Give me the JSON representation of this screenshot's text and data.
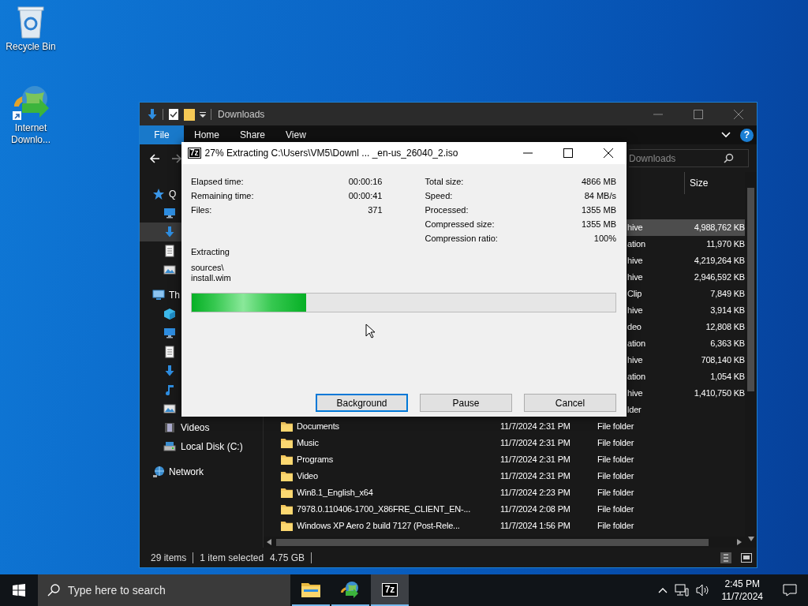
{
  "desktop_icons": [
    {
      "kind": "recycle-bin",
      "label": "Recycle Bin"
    },
    {
      "kind": "downloader",
      "label": "Internet Downlo..."
    }
  ],
  "explorer": {
    "title": "Downloads",
    "ribbon_tabs": [
      {
        "kind": "file",
        "label": "File"
      },
      {
        "kind": "tab",
        "label": "Home"
      },
      {
        "kind": "tab",
        "label": "Share"
      },
      {
        "kind": "tab",
        "label": "View"
      }
    ],
    "help_label": "?",
    "search": {
      "placeholder": "Downloads"
    },
    "columns": [
      {
        "label": "Size"
      }
    ],
    "nav": [
      {
        "kind": "star",
        "label": "Q",
        "selected": false,
        "children": [
          {
            "kind": "monitor",
            "selected": false
          },
          {
            "kind": "download",
            "selected": true
          },
          {
            "kind": "document",
            "selected": false
          },
          {
            "kind": "picture",
            "selected": false
          }
        ]
      },
      {
        "kind": "computer",
        "label": "Th",
        "selected": false,
        "children": [
          {
            "kind": "cube",
            "selected": false
          },
          {
            "kind": "monitor",
            "selected": false
          },
          {
            "kind": "document",
            "selected": false
          },
          {
            "kind": "download",
            "selected": false
          },
          {
            "kind": "music",
            "selected": false
          },
          {
            "kind": "picture",
            "selected": false
          },
          {
            "kind": "film",
            "label": "Videos",
            "selected": false
          },
          {
            "kind": "drive",
            "label": "Local Disk (C:)",
            "selected": false
          }
        ]
      },
      {
        "kind": "network",
        "label": "Network",
        "selected": false
      }
    ],
    "files": [
      {
        "kind": "covered",
        "type": "hive",
        "size": "4,988,762 KB",
        "selected": true
      },
      {
        "kind": "covered",
        "type": "ation",
        "size": "11,970 KB",
        "selected": false
      },
      {
        "kind": "covered",
        "type": "hive",
        "size": "4,219,264 KB",
        "selected": false
      },
      {
        "kind": "covered",
        "type": "hive",
        "size": "2,946,592 KB",
        "selected": false
      },
      {
        "kind": "covered",
        "type": "Clip",
        "size": "7,849 KB",
        "selected": false
      },
      {
        "kind": "covered",
        "type": "hive",
        "size": "3,914 KB",
        "selected": false
      },
      {
        "kind": "covered",
        "type": "deo",
        "size": "12,808 KB",
        "selected": false
      },
      {
        "kind": "covered",
        "type": "ation",
        "size": "6,363 KB",
        "selected": false
      },
      {
        "kind": "covered",
        "type": "hive",
        "size": "708,140 KB",
        "selected": false
      },
      {
        "kind": "covered",
        "type": "ation",
        "size": "1,054 KB",
        "selected": false
      },
      {
        "kind": "covered",
        "type": "hive",
        "size": "1,410,750 KB",
        "selected": false
      },
      {
        "kind": "covered",
        "type": "lder",
        "selected": false
      },
      {
        "kind": "folder",
        "name": "Documents",
        "date": "11/7/2024 2:31 PM",
        "type": "File folder",
        "selected": false
      },
      {
        "kind": "folder",
        "name": "Music",
        "date": "11/7/2024 2:31 PM",
        "type": "File folder",
        "selected": false
      },
      {
        "kind": "folder",
        "name": "Programs",
        "date": "11/7/2024 2:31 PM",
        "type": "File folder",
        "selected": false
      },
      {
        "kind": "folder",
        "name": "Video",
        "date": "11/7/2024 2:31 PM",
        "type": "File folder",
        "selected": false
      },
      {
        "kind": "folder",
        "name": "Win8.1_English_x64",
        "date": "11/7/2024 2:23 PM",
        "type": "File folder",
        "selected": false
      },
      {
        "kind": "folder",
        "name": "7978.0.110406-1700_X86FRE_CLIENT_EN-...",
        "date": "11/7/2024 2:08 PM",
        "type": "File folder",
        "selected": false
      },
      {
        "kind": "folder",
        "name": "Windows XP Aero 2 build 7127 (Post-Rele...",
        "date": "11/7/2024 1:56 PM",
        "type": "File folder",
        "selected": false
      }
    ],
    "status_bar": {
      "items": "29 items",
      "selection": "1 item selected",
      "selection_size": "4.75 GB"
    }
  },
  "dialog": {
    "logo": "7z",
    "title": "27% Extracting C:\\Users\\VM5\\Downl ... _en-us_26040_2.iso",
    "stats_left": [
      {
        "label": "Elapsed time:",
        "value": "00:00:16"
      },
      {
        "label": "Remaining time:",
        "value": "00:00:41"
      },
      {
        "label": "Files:",
        "value": "371"
      }
    ],
    "stats_right": [
      {
        "label": "Total size:",
        "value": "4866 MB"
      },
      {
        "label": "Speed:",
        "value": "84 MB/s"
      },
      {
        "label": "Processed:",
        "value": "1355 MB"
      },
      {
        "label": "Compressed size:",
        "value": "1355 MB"
      },
      {
        "label": "Compression ratio:",
        "value": "100%"
      }
    ],
    "status": "Extracting",
    "current_file": [
      "sources\\",
      "install.wim"
    ],
    "progress": {
      "level": 0.27
    },
    "buttons": [
      {
        "label": "Background",
        "focused": true
      },
      {
        "label": "Pause",
        "focused": false
      },
      {
        "label": "Cancel",
        "focused": false
      }
    ]
  },
  "taskbar": {
    "search": {
      "placeholder": "Type here to search"
    },
    "apps": [
      {
        "kind": "folder",
        "running": true,
        "active": false
      },
      {
        "kind": "downloader",
        "running": true,
        "active": false
      },
      {
        "kind": "sevenzip",
        "label": "7z",
        "running": true,
        "active": true
      }
    ],
    "clock": {
      "time": "2:45 PM",
      "date": "11/7/2024"
    }
  }
}
